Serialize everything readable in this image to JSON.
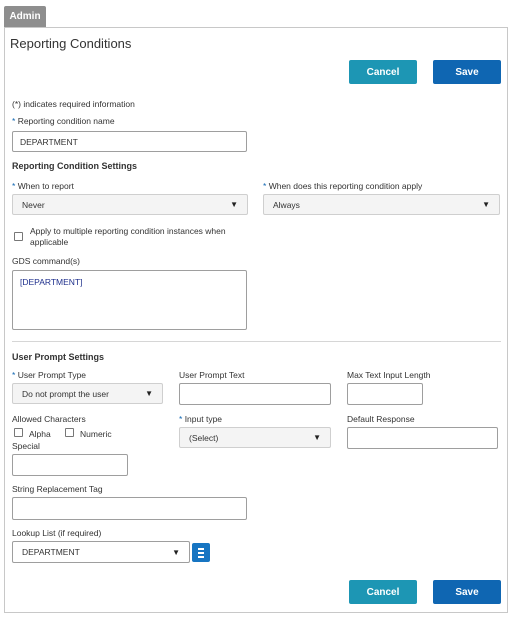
{
  "tab": {
    "label": "Admin"
  },
  "page": {
    "title": "Reporting Conditions"
  },
  "buttons": {
    "cancel": "Cancel",
    "save": "Save"
  },
  "required_note": "(*) indicates required information",
  "condition_name": {
    "asterisk": "*",
    "label": "Reporting condition name",
    "value": "DEPARTMENT"
  },
  "settings": {
    "heading": "Reporting Condition Settings",
    "when_to_report": {
      "label": "When to report",
      "value": "Never"
    },
    "when_apply": {
      "label": "When does this reporting condition apply",
      "value": "Always"
    },
    "multiple_instances": {
      "label_line1": "Apply to multiple reporting condition instances when",
      "label_line2": "applicable",
      "checked": false
    },
    "gds": {
      "label": "GDS command(s)",
      "value": "[DEPARTMENT]"
    }
  },
  "prompt": {
    "heading": "User Prompt Settings",
    "prompt_type": {
      "label": "User Prompt Type",
      "value": "Do not prompt the user"
    },
    "prompt_text": {
      "label": "User Prompt Text",
      "value": ""
    },
    "max_length": {
      "label": "Max Text Input Length",
      "value": ""
    },
    "allowed": {
      "label": "Allowed Characters",
      "alpha": "Alpha",
      "numeric": "Numeric",
      "special": "Special"
    },
    "input_type": {
      "label": "Input type",
      "value": "(Select)"
    },
    "default_response": {
      "label": "Default Response",
      "value": ""
    },
    "special_value": "",
    "replacement_tag": {
      "label": "String Replacement Tag",
      "value": ""
    },
    "lookup": {
      "label": "Lookup List (if required)",
      "value": "DEPARTMENT"
    }
  },
  "colors": {
    "cancel": "#1d96b4",
    "save": "#0f66b2",
    "required": "#0f66b2"
  },
  "icons": {
    "dropdown": "caret-down-icon",
    "list": "list-icon"
  }
}
